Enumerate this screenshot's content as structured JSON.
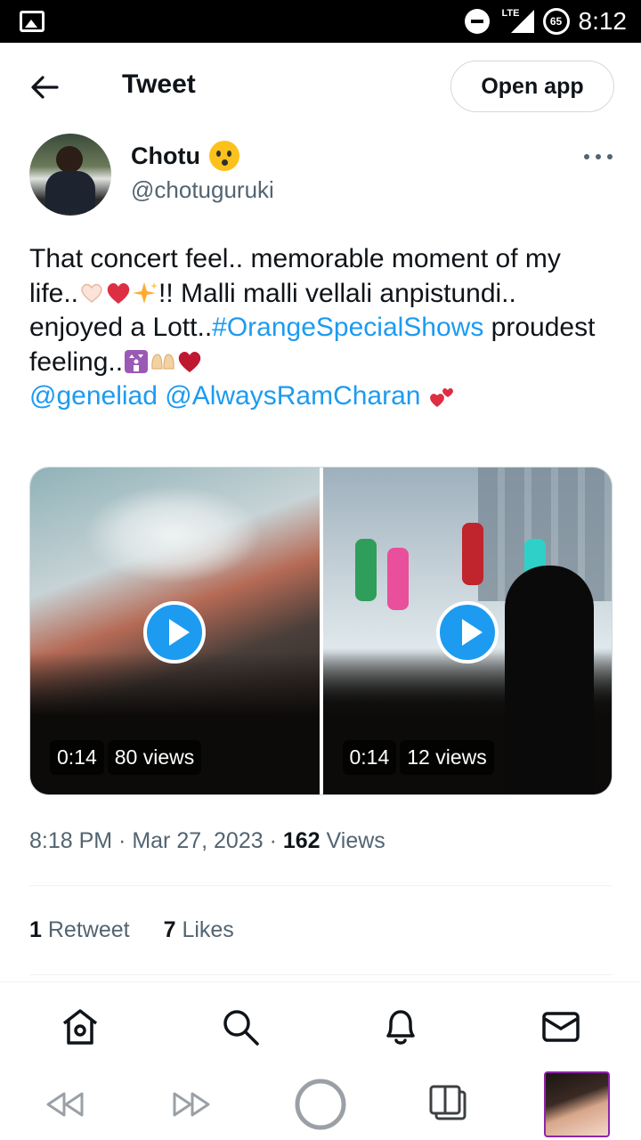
{
  "status_bar": {
    "network": "LTE",
    "battery": "65",
    "time": "8:12"
  },
  "header": {
    "title": "Tweet",
    "open_app_label": "Open app"
  },
  "author": {
    "name": "Chotu",
    "handle": "@chotuguruki"
  },
  "tweet": {
    "text_1": "That concert feel.. memorable moment of my life..",
    "text_2": "!! Malli malli vellali anpistundi.. enjoyed a Lott..",
    "hashtag": "#OrangeSpecialShows",
    "text_3": " proudest feeling..",
    "mention_1": "@geneliad",
    "mention_2": "@AlwaysRamCharan"
  },
  "media": [
    {
      "duration": "0:14",
      "views": "80 views"
    },
    {
      "duration": "0:14",
      "views": "12 views"
    }
  ],
  "meta": {
    "time": "8:18 PM",
    "date": "Mar 27, 2023",
    "views_count": "162",
    "views_label": "Views"
  },
  "stats": {
    "retweets_count": "1",
    "retweets_label": "Retweet",
    "likes_count": "7",
    "likes_label": "Likes"
  },
  "nav": [
    "home-icon",
    "search-icon",
    "notifications-icon",
    "messages-icon"
  ],
  "colors": {
    "link": "#1d9bf0",
    "text": "#0f1419",
    "secondary": "#536471"
  }
}
